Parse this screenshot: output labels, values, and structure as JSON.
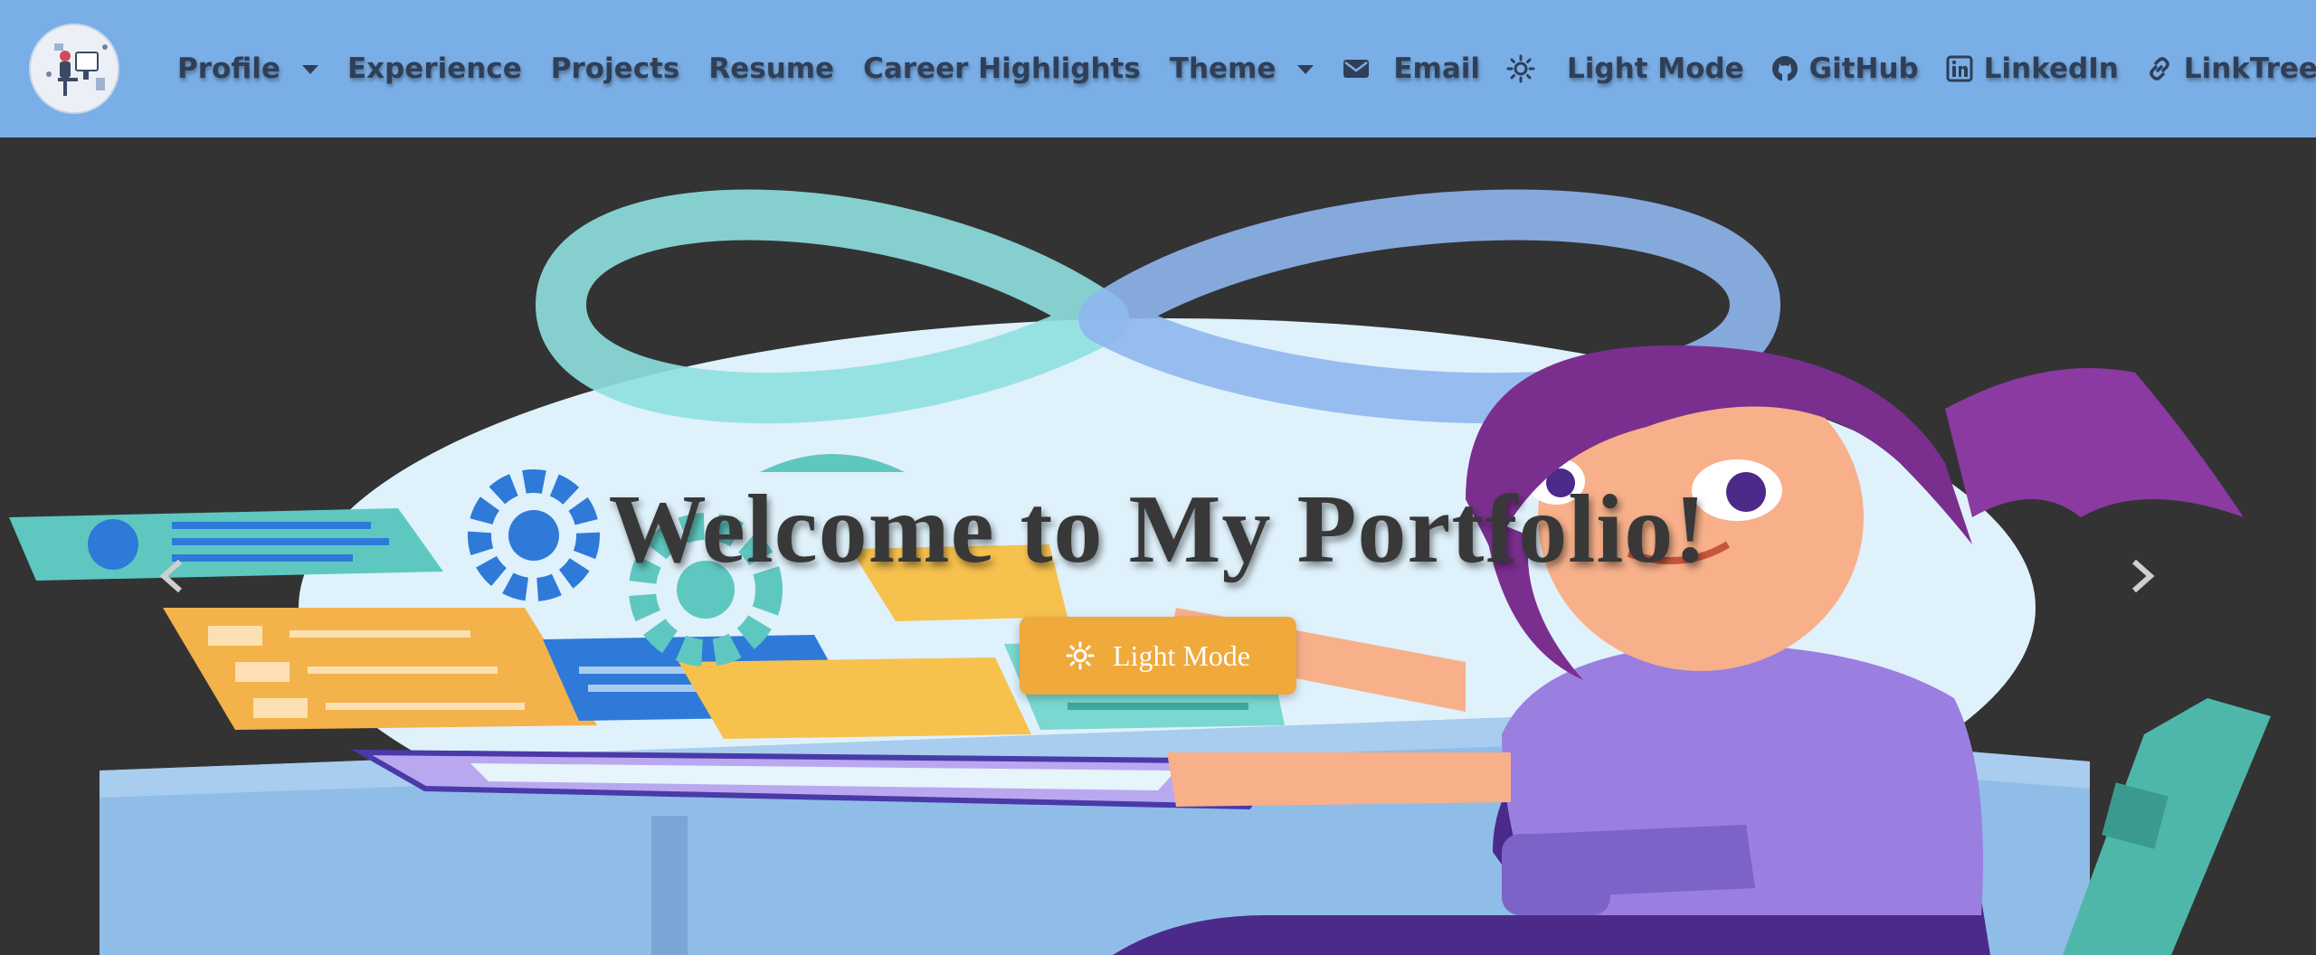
{
  "nav": {
    "left": [
      {
        "label": "Profile",
        "dropdown": true
      },
      {
        "label": "Experience"
      },
      {
        "label": "Projects"
      },
      {
        "label": "Resume"
      },
      {
        "label": "Career Highlights"
      },
      {
        "label": "Theme",
        "dropdown": true
      }
    ],
    "right": [
      {
        "label": "Email",
        "icon": "envelope-icon"
      },
      {
        "label": "Light Mode",
        "icon": "sun-icon"
      },
      {
        "label": "GitHub",
        "icon": "github-icon"
      },
      {
        "label": "LinkedIn",
        "icon": "linkedin-icon"
      },
      {
        "label": "LinkTree",
        "icon": "link-icon"
      }
    ]
  },
  "hero": {
    "title": "Welcome to My Portfolio!",
    "button_label": "Light Mode",
    "button_icon": "sun-icon"
  },
  "colors": {
    "navbar": "#7aaee6",
    "nav_text": "#2f3f57",
    "hero_bg": "#333333",
    "button": "#f0a93b"
  }
}
